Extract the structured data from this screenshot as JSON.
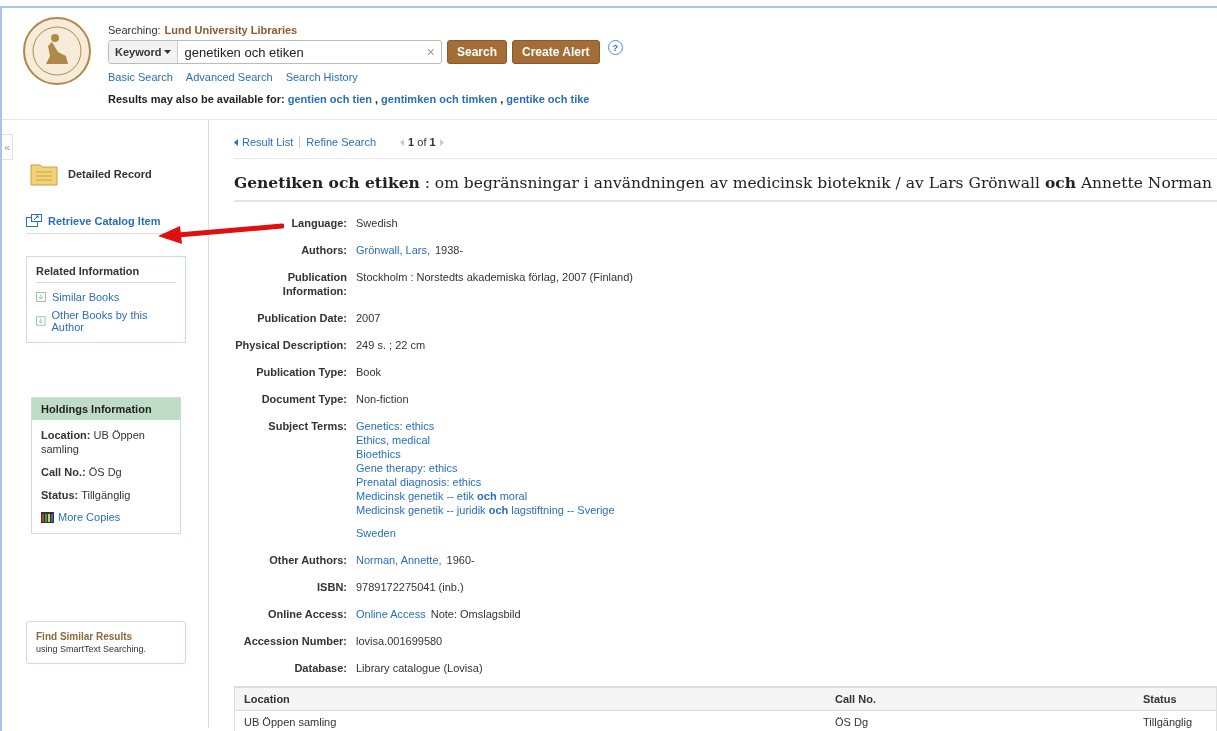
{
  "header": {
    "searching_label": "Searching:",
    "searching_source": "Lund University Libraries",
    "search_type": "Keyword",
    "query": "genetiken och etiken",
    "clear": "×",
    "buttons": [
      "Search",
      "Create Alert"
    ],
    "help": "?",
    "links": [
      "Basic Search",
      "Advanced Search",
      "Search History"
    ],
    "suggest_label": "Results may also be available for:",
    "suggestion_separator": ",",
    "suggestions": [
      "gentien och tien",
      "gentimken och timken",
      "gentike och tike"
    ]
  },
  "sidebar": {
    "collapse": "«",
    "detailed_record": "Detailed Record",
    "retrieve": "Retrieve Catalog Item",
    "related": {
      "title": "Related Information",
      "links": [
        "Similar Books",
        "Other Books by this Author"
      ]
    },
    "holdings": {
      "title": "Holdings Information",
      "rows": [
        {
          "label": "Location:",
          "value": "UB Öppen samling"
        },
        {
          "label": "Call No.:",
          "value": "ÖS Dg"
        },
        {
          "label": "Status:",
          "value": "Tillgänglig"
        }
      ],
      "more": "More Copies"
    },
    "find_similar": {
      "title": "Find Similar Results",
      "subtitle": "using SmartText Searching."
    }
  },
  "nav": {
    "result_list": "Result List",
    "refine": "Refine Search",
    "position": "**1** of **1**"
  },
  "title": "**Genetiken och etiken** : om begränsningar i användningen av medicinsk bioteknik / av Lars Grönwall **och** Annette Norman",
  "fields": [
    {
      "label": "Language:",
      "groups": [
        [
          [
            {
              "kind": "text",
              "text": "Swedish"
            }
          ]
        ]
      ]
    },
    {
      "label": "Authors:",
      "groups": [
        [
          [
            {
              "kind": "link",
              "text": "Grönwall, Lars,"
            },
            {
              "kind": "text",
              "text": "1938-"
            }
          ]
        ]
      ]
    },
    {
      "label": "Publication Information:",
      "groups": [
        [
          [
            {
              "kind": "text",
              "text": "Stockholm : Norstedts akademiska förlag, 2007 (Finland)"
            }
          ]
        ]
      ]
    },
    {
      "label": "Publication Date:",
      "groups": [
        [
          [
            {
              "kind": "text",
              "text": "2007"
            }
          ]
        ]
      ]
    },
    {
      "label": "Physical Description:",
      "groups": [
        [
          [
            {
              "kind": "text",
              "text": "249 s. ; 22 cm"
            }
          ]
        ]
      ]
    },
    {
      "label": "Publication Type:",
      "groups": [
        [
          [
            {
              "kind": "text",
              "text": "Book"
            }
          ]
        ]
      ]
    },
    {
      "label": "Document Type:",
      "groups": [
        [
          [
            {
              "kind": "text",
              "text": "Non-fiction"
            }
          ]
        ]
      ]
    },
    {
      "label": "Subject Terms:",
      "groups": [
        [
          [
            {
              "kind": "link",
              "text": "Genetics: ethics"
            }
          ],
          [
            {
              "kind": "link",
              "text": "Ethics, medical"
            }
          ],
          [
            {
              "kind": "link",
              "text": "Bioethics"
            }
          ],
          [
            {
              "kind": "link",
              "text": "Gene therapy: ethics"
            }
          ],
          [
            {
              "kind": "link",
              "text": "Prenatal diagnosis: ethics"
            }
          ],
          [
            {
              "kind": "link",
              "text": "Medicinsk genetik -- etik **och** moral"
            }
          ],
          [
            {
              "kind": "link",
              "text": "Medicinsk genetik -- juridik **och** lagstiftning -- Sverige"
            }
          ]
        ],
        [
          [
            {
              "kind": "link",
              "text": "Sweden"
            }
          ]
        ]
      ]
    },
    {
      "label": "Other Authors:",
      "groups": [
        [
          [
            {
              "kind": "link",
              "text": "Norman, Annette,"
            },
            {
              "kind": "text",
              "text": "1960-"
            }
          ]
        ]
      ]
    },
    {
      "label": "ISBN:",
      "groups": [
        [
          [
            {
              "kind": "text",
              "text": "9789172275041 (inb.)"
            }
          ]
        ]
      ]
    },
    {
      "label": "Online Access:",
      "groups": [
        [
          [
            {
              "kind": "link",
              "text": "Online Access"
            },
            {
              "kind": "text",
              "text": "Note: Omslagsbild"
            }
          ]
        ]
      ]
    },
    {
      "label": "Accession Number:",
      "groups": [
        [
          [
            {
              "kind": "text",
              "text": "lovisa.001699580"
            }
          ]
        ]
      ]
    },
    {
      "label": "Database:",
      "groups": [
        [
          [
            {
              "kind": "text",
              "text": "Library catalogue (Lovisa)"
            }
          ]
        ]
      ]
    }
  ],
  "holdings_table": {
    "columns": [
      "Location",
      "Call No.",
      "Status"
    ],
    "rows": [
      [
        "UB Öppen samling",
        "ÖS Dg",
        "Tillgänglig"
      ]
    ]
  }
}
